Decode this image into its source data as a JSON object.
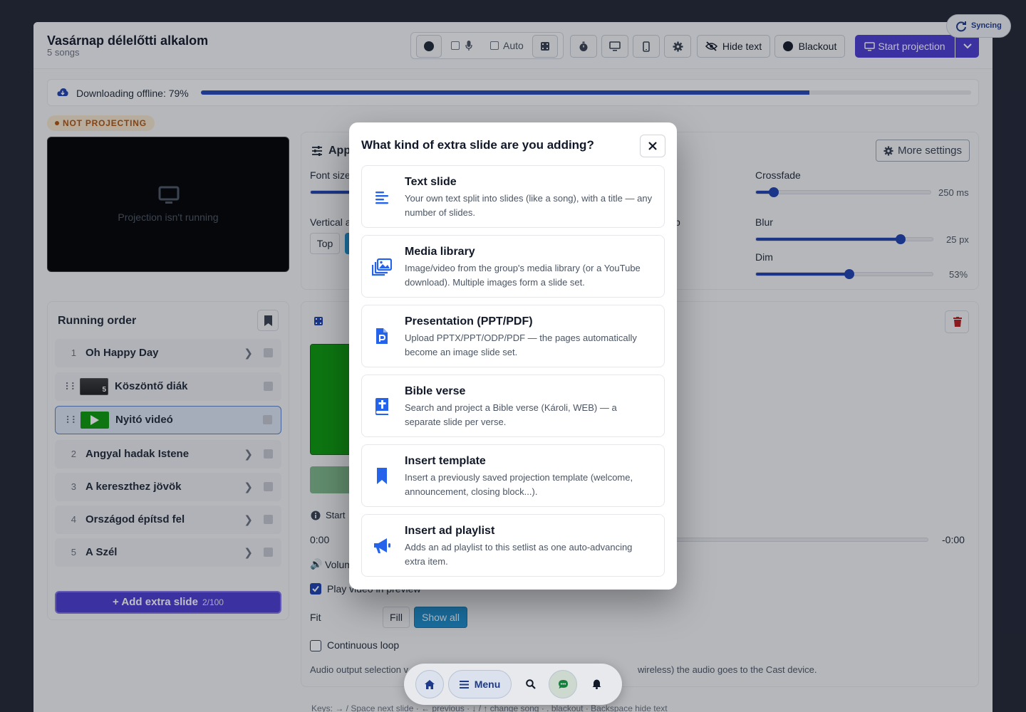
{
  "header": {
    "title": "Vasárnap délelőtti alkalom",
    "subtitle": "5 songs"
  },
  "toolbar": {
    "auto_label": "Auto",
    "hide_text_label": "Hide text",
    "blackout_label": "Blackout",
    "start_projection_label": "Start projection"
  },
  "sync": {
    "label": "Syncing"
  },
  "download": {
    "label": "Downloading offline: 79%",
    "progress": 0.79
  },
  "status": {
    "badge": "NOT PROJECTING"
  },
  "preview": {
    "text": "Projection isn't running"
  },
  "appearance": {
    "title": "App",
    "more_settings": "More settings",
    "font_size_label": "Font size",
    "vertical_label": "Vertical a",
    "top_label": "Top",
    "crossfade_label": "Crossfade",
    "crossfade_value": "250 ms",
    "crossfade_level": 0.1,
    "blur_label": "Blur",
    "blur_value": "25 px",
    "blur_level": 0.82,
    "dim_label": "Dim",
    "dim_value": "53%",
    "dim_level": 0.53,
    "stray": "p"
  },
  "running_order": {
    "title": "Running order",
    "items": [
      {
        "num": "1",
        "name": "Oh Happy Day"
      },
      {
        "num": "",
        "name": "Köszöntő diák",
        "thumb_badge": "5"
      },
      {
        "num": "",
        "name": "Nyitó videó"
      },
      {
        "num": "2",
        "name": "Angyal hadak Istene"
      },
      {
        "num": "3",
        "name": "A kereszthez jövök"
      },
      {
        "num": "4",
        "name": "Országod építsd fel"
      },
      {
        "num": "5",
        "name": "A Szél"
      }
    ],
    "add_label": "Add extra slide",
    "add_count": "2/100"
  },
  "media_panel": {
    "start_label": "Start",
    "time_start": "0:00",
    "time_end": "-0:00",
    "volume_label": "Volum",
    "play_video_label": "Play video in preview",
    "fit_label": "Fit",
    "fill_label": "Fill",
    "show_all_label": "Show all",
    "loop_label": "Continuous loop",
    "audio_note_left": "Audio output selection v",
    "audio_note_right": "wireless) the audio goes to the Cast device.",
    "keys_hint": "Keys: → / Space next slide · ← previous · ↓ / ↑ change song · . blackout · Backspace hide text"
  },
  "modal": {
    "title": "What kind of extra slide are you adding?",
    "options": [
      {
        "title": "Text slide",
        "desc": "Your own text split into slides (like a song), with a title — any number of slides.",
        "icon": "text-lines-icon"
      },
      {
        "title": "Media library",
        "desc": "Image/video from the group's media library (or a YouTube download). Multiple images form a slide set.",
        "icon": "images-icon"
      },
      {
        "title": "Presentation (PPT/PDF)",
        "desc": "Upload PPTX/PPT/ODP/PDF — the pages automatically become an image slide set.",
        "icon": "file-powerpoint-icon"
      },
      {
        "title": "Bible verse",
        "desc": "Search and project a Bible verse (Károli, WEB) — a separate slide per verse.",
        "icon": "bible-icon"
      },
      {
        "title": "Insert template",
        "desc": "Insert a previously saved projection template (welcome, announcement, closing block...).",
        "icon": "bookmark-icon"
      },
      {
        "title": "Insert ad playlist",
        "desc": "Adds an ad playlist to this setlist as one auto-advancing extra item.",
        "icon": "megaphone-icon"
      }
    ]
  },
  "bottom_nav": {
    "menu_label": "Menu"
  },
  "colors": {
    "accent": "#1e40af",
    "primary_purple": "#4a3bd0",
    "amber": "#b45309"
  }
}
